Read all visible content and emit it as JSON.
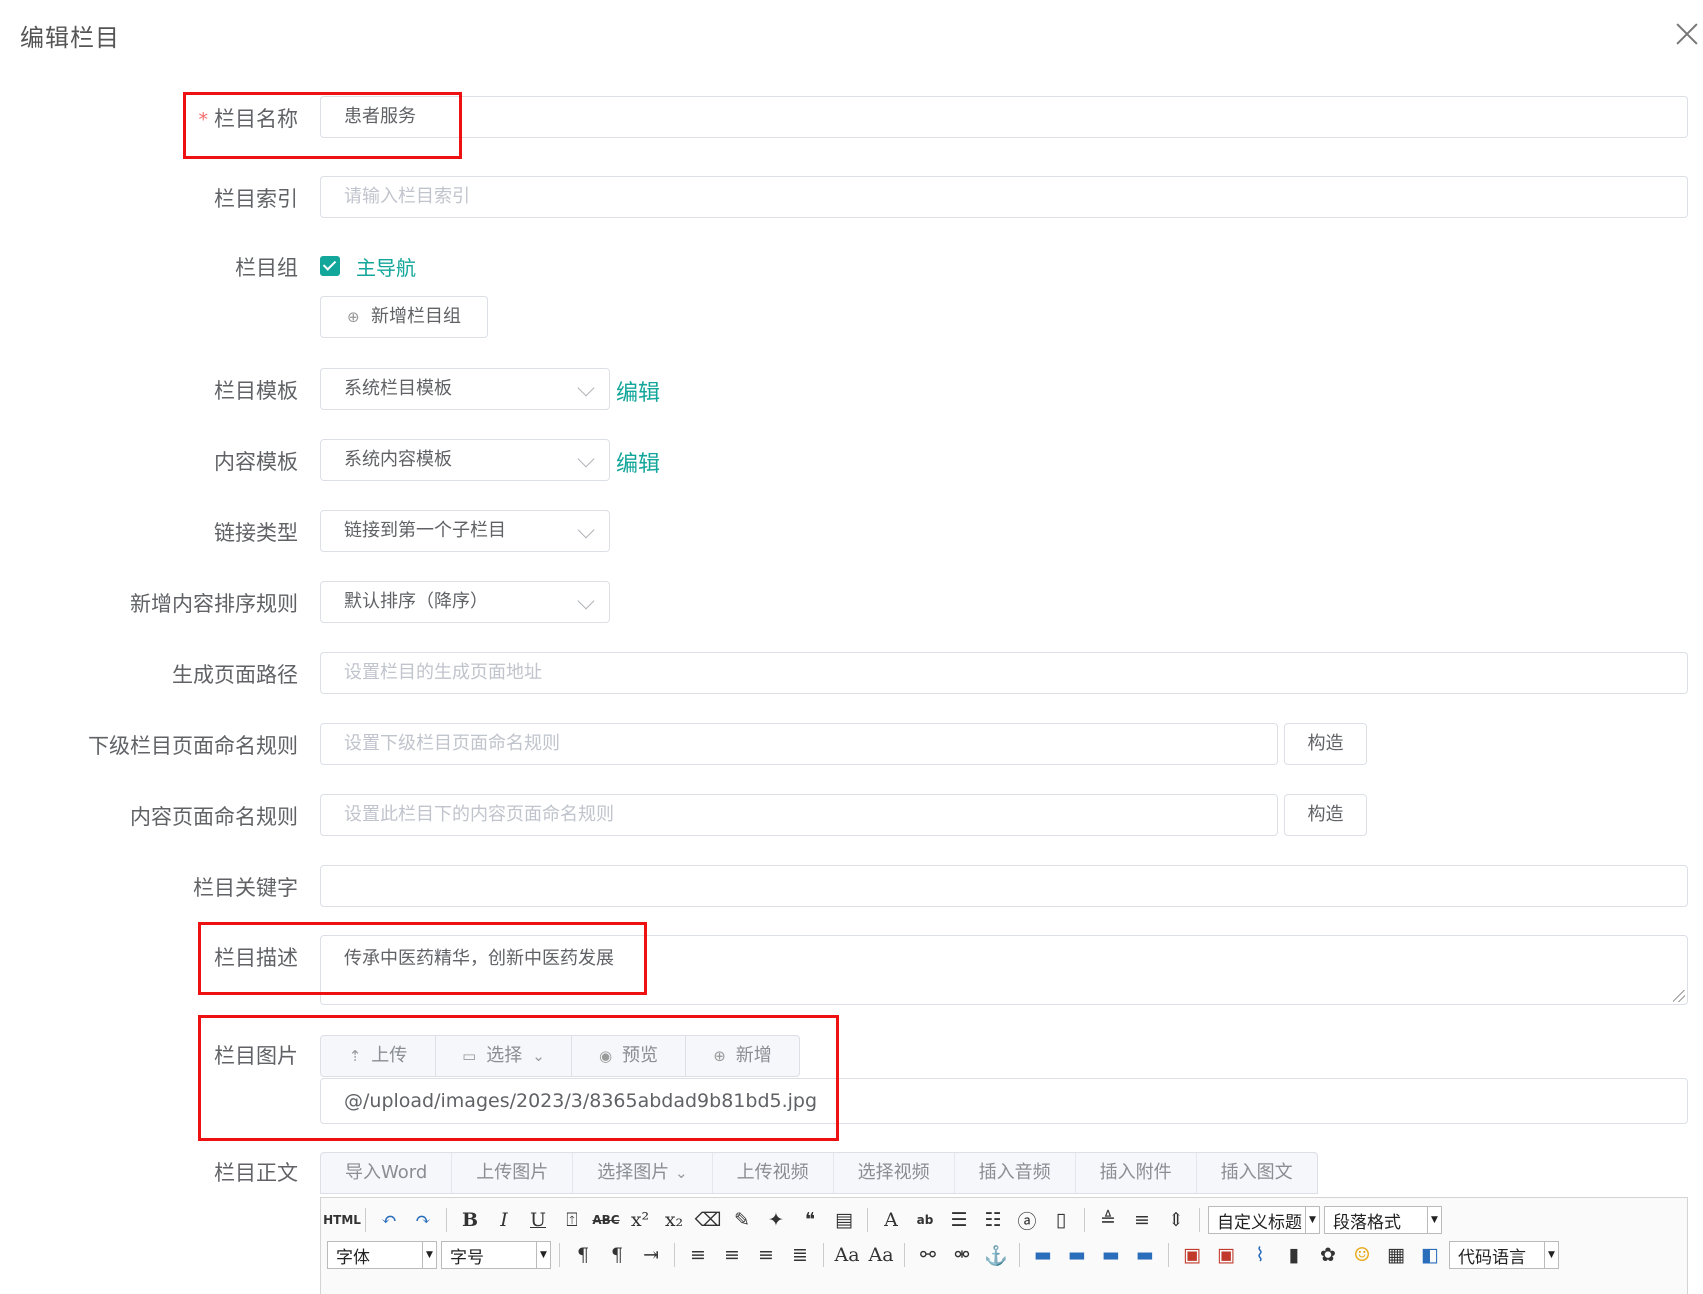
{
  "dialog": {
    "title": "编辑栏目"
  },
  "form": {
    "name": {
      "label": "栏目名称",
      "required_mark": "*",
      "value": "患者服务"
    },
    "index": {
      "label": "栏目索引",
      "placeholder": "请输入栏目索引"
    },
    "group": {
      "label": "栏目组",
      "checkbox_label": "主导航",
      "checked": true,
      "add_button": "新增栏目组"
    },
    "column_template": {
      "label": "栏目模板",
      "value": "系统栏目模板",
      "edit_link": "编辑"
    },
    "content_template": {
      "label": "内容模板",
      "value": "系统内容模板",
      "edit_link": "编辑"
    },
    "link_type": {
      "label": "链接类型",
      "value": "链接到第一个子栏目"
    },
    "sort_rule": {
      "label": "新增内容排序规则",
      "value": "默认排序（降序）"
    },
    "page_path": {
      "label": "生成页面路径",
      "placeholder": "设置栏目的生成页面地址"
    },
    "child_naming": {
      "label": "下级栏目页面命名规则",
      "placeholder": "设置下级栏目页面命名规则",
      "button": "构造"
    },
    "content_naming": {
      "label": "内容页面命名规则",
      "placeholder": "设置此栏目下的内容页面命名规则",
      "button": "构造"
    },
    "keywords": {
      "label": "栏目关键字",
      "value": ""
    },
    "description": {
      "label": "栏目描述",
      "value": "传承中医药精华，创新中医药发展"
    },
    "image": {
      "label": "栏目图片",
      "buttons": [
        "上传",
        "选择",
        "预览",
        "新增"
      ],
      "value": "@/upload/images/2023/3/8365abdad9b81bd5.jpg"
    },
    "body": {
      "label": "栏目正文",
      "tabs": [
        "导入Word",
        "上传图片",
        "选择图片",
        "上传视频",
        "选择视频",
        "插入音频",
        "插入附件",
        "插入图文"
      ],
      "editor": {
        "custom_title": "自定义标题",
        "paragraph": "段落格式",
        "font": "字体",
        "font_size": "字号",
        "code_lang": "代码语言"
      }
    }
  },
  "colors": {
    "accent": "#13a69a",
    "highlight_box": "#ee1111",
    "required": "#f56c6c"
  }
}
